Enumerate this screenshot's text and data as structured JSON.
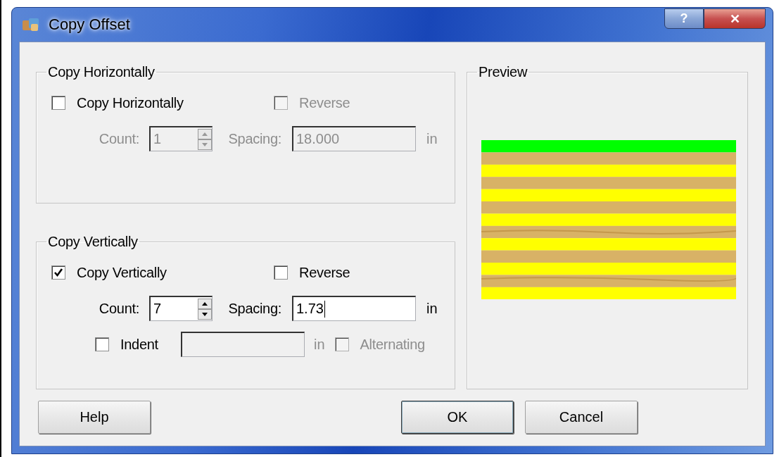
{
  "window": {
    "title": "Copy Offset"
  },
  "title_buttons": [
    {
      "kind": "help",
      "label": "?"
    },
    {
      "kind": "close",
      "label": "✕"
    }
  ],
  "horizontal": {
    "title": "Copy Horizontally",
    "enable": {
      "label": "Copy Horizontally",
      "checked": false
    },
    "reverse": {
      "label": "Reverse",
      "checked": false,
      "disabled": true
    },
    "count": {
      "label": "Count:",
      "value": "1",
      "disabled": true
    },
    "spacing": {
      "label": "Spacing:",
      "value": "18.000",
      "unit": "in",
      "disabled": true,
      "focused": false
    }
  },
  "vertical": {
    "title": "Copy Vertically",
    "enable": {
      "label": "Copy Vertically",
      "checked": true
    },
    "reverse": {
      "label": "Reverse",
      "checked": false,
      "disabled": false
    },
    "count": {
      "label": "Count:",
      "value": "7",
      "disabled": false
    },
    "spacing": {
      "label": "Spacing:",
      "value": "1.73",
      "unit": "in",
      "disabled": false,
      "focused": true
    },
    "indent": {
      "label": "Indent",
      "checked": false,
      "field_disabled": true,
      "unit": "in"
    },
    "alternating": {
      "label": "Alternating",
      "checked": false,
      "disabled": true
    }
  },
  "preview": {
    "title": "Preview"
  },
  "buttons": [
    {
      "label": "Help",
      "default": false
    },
    {
      "label": "OK",
      "default": true
    },
    {
      "label": "Cancel",
      "default": false
    }
  ]
}
